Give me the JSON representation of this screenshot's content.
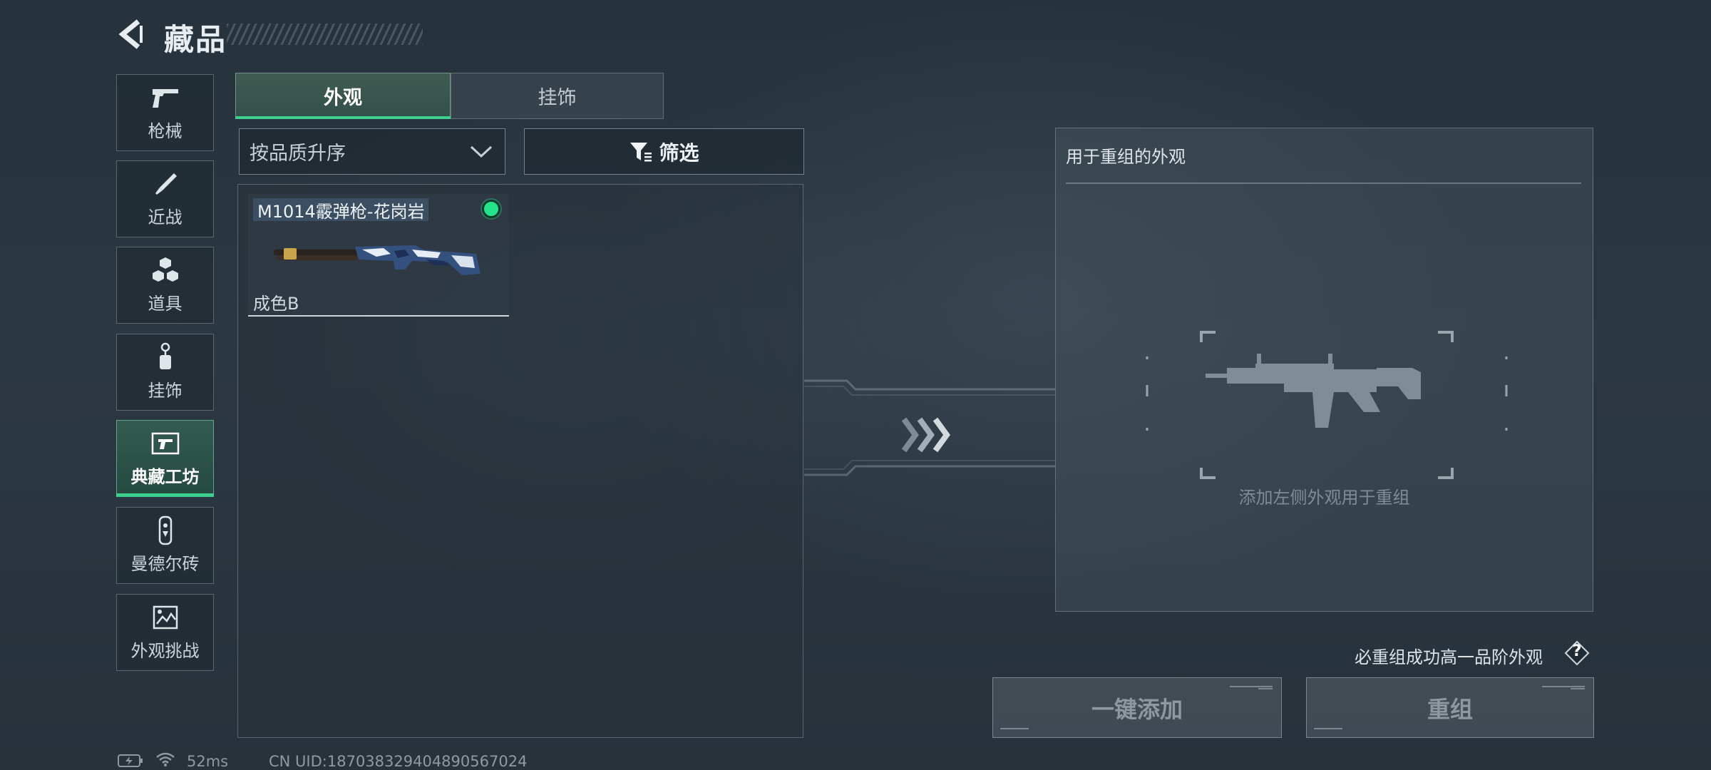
{
  "header": {
    "title": "藏品"
  },
  "sidebar": {
    "items": [
      {
        "label": "枪械",
        "icon": "pistol-icon"
      },
      {
        "label": "近战",
        "icon": "knife-icon"
      },
      {
        "label": "道具",
        "icon": "grenades-icon"
      },
      {
        "label": "挂饰",
        "icon": "charm-icon"
      },
      {
        "label": "典藏工坊",
        "icon": "workshop-icon",
        "active": true
      },
      {
        "label": "曼德尔砖",
        "icon": "brick-icon"
      },
      {
        "label": "外观挑战",
        "icon": "challenge-icon"
      }
    ]
  },
  "tabs": [
    {
      "label": "外观",
      "active": true
    },
    {
      "label": "挂饰",
      "active": false
    }
  ],
  "toolbar": {
    "sort_value": "按品质升序",
    "filter_label": "筛选"
  },
  "items": [
    {
      "name": "M1014霰弹枪-花岗岩",
      "grade": "成色B",
      "status_color": "#24e38a"
    }
  ],
  "reorg_panel": {
    "title": "用于重组的外观",
    "hint": "添加左侧外观用于重组"
  },
  "bottom": {
    "bonus_text": "必重组成功高一品阶外观",
    "help_label": "?",
    "add_all_label": "一键添加",
    "reorg_label": "重组"
  },
  "status_bar": {
    "ping": "52ms",
    "uid": "CN UID:1870383294048905670​24"
  },
  "colors": {
    "accent": "#3ccf8e",
    "status_dot": "#24e38a"
  }
}
